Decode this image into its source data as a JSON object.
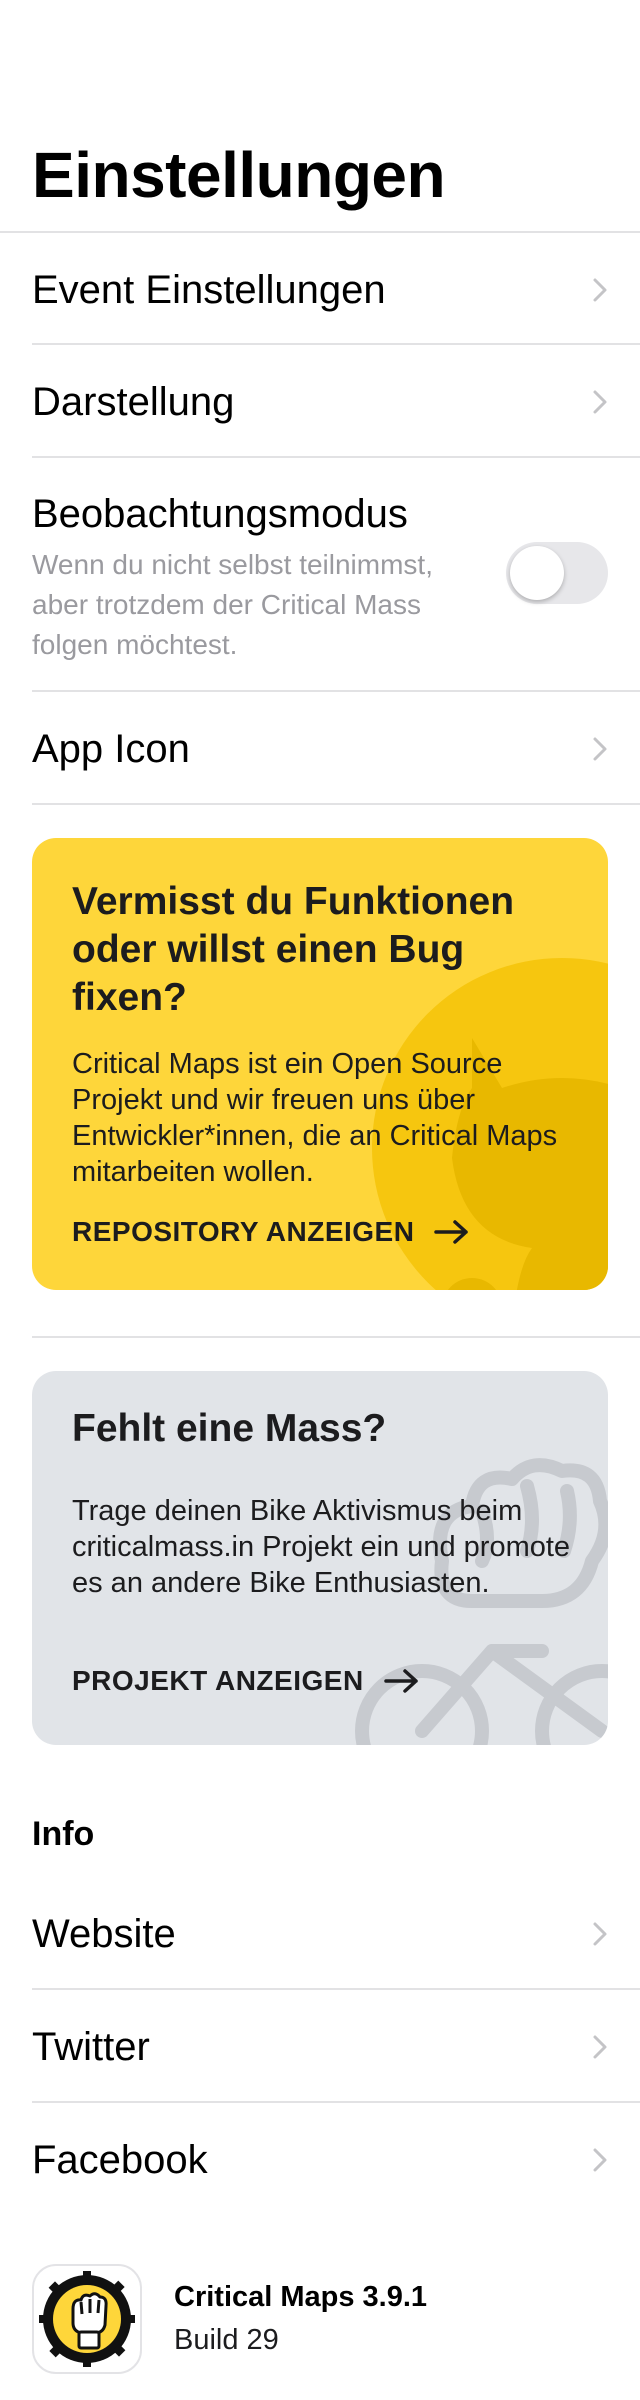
{
  "page": {
    "title": "Einstellungen"
  },
  "settings": {
    "event_settings": "Event Einstellungen",
    "appearance": "Darstellung",
    "observation": {
      "title": "Beobachtungsmodus",
      "description": "Wenn du nicht selbst teilnimmst, aber trotzdem der Critical Mass folgen möchtest.",
      "enabled": false
    },
    "app_icon": "App Icon"
  },
  "contribute_card": {
    "title": "Vermisst du Funktionen oder willst einen Bug fixen?",
    "text": "Critical Maps ist ein Open Source Projekt und wir freuen uns über Entwickler*innen, die an Critical Maps mitarbeiten wollen.",
    "link": "REPOSITORY ANZEIGEN",
    "background_color": "#fed63a",
    "decoration_icon": "github-icon"
  },
  "missing_mass_card": {
    "title": "Fehlt eine Mass?",
    "text": "Trage deinen Bike Aktivismus beim criticalmass.in Projekt ein und promote es an andere Bike Enthusiasten.",
    "link": "PROJEKT ANZEIGEN",
    "background_color": "#e1e4e8",
    "decoration_icon": "bike-fist-icon"
  },
  "info": {
    "header": "Info",
    "items": [
      {
        "label": "Website"
      },
      {
        "label": "Twitter"
      },
      {
        "label": "Facebook"
      }
    ]
  },
  "footer": {
    "app_name": "Critical Maps 3.9.1",
    "build": "Build 29",
    "icon": "critical-maps-fist-icon",
    "icon_color": "#fed63a"
  }
}
